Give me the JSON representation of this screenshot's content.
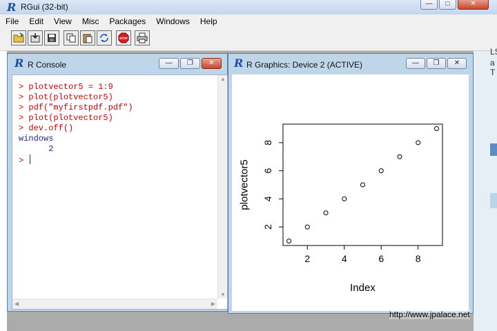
{
  "app": {
    "title": "RGui (32-bit)",
    "logo": "R"
  },
  "menu": [
    "File",
    "Edit",
    "View",
    "Misc",
    "Packages",
    "Windows",
    "Help"
  ],
  "toolbar": {
    "buttons": [
      "open-script-icon",
      "load-workspace-icon",
      "save-icon",
      "copy-icon",
      "paste-icon",
      "copy-paste-icon",
      "stop-icon",
      "print-icon"
    ],
    "stop_label": "STOP"
  },
  "console": {
    "title": "R Console",
    "lines": [
      {
        "prompt": "> ",
        "text": "plotvector5 = 1:9",
        "kind": "cmd"
      },
      {
        "prompt": "> ",
        "text": "plot(plotvector5)",
        "kind": "cmd"
      },
      {
        "prompt": "> ",
        "text": "pdf(\"myfirstpdf.pdf\")",
        "kind": "cmd"
      },
      {
        "prompt": "> ",
        "text": "plot(plotvector5)",
        "kind": "cmd"
      },
      {
        "prompt": "> ",
        "text": "dev.off()",
        "kind": "cmd"
      },
      {
        "prompt": "",
        "text": "windows",
        "kind": "out"
      },
      {
        "prompt": "",
        "text": "      2",
        "kind": "out"
      },
      {
        "prompt": "> ",
        "text": "",
        "kind": "cmd"
      }
    ]
  },
  "graphics": {
    "title": "R Graphics: Device 2 (ACTIVE)",
    "chart_data": {
      "type": "scatter",
      "x": [
        1,
        2,
        3,
        4,
        5,
        6,
        7,
        8,
        9
      ],
      "y": [
        1,
        2,
        3,
        4,
        5,
        6,
        7,
        8,
        9
      ],
      "xlabel": "Index",
      "ylabel": "plotvector5",
      "xlim": [
        1,
        9
      ],
      "ylim": [
        1,
        9
      ],
      "xticks": [
        "2",
        "4",
        "6",
        "8"
      ],
      "yticks": [
        "2",
        "4",
        "6",
        "8"
      ],
      "marker": "open-circle",
      "grid": false
    }
  },
  "background": {
    "right_fragments": [
      "LS",
      "a T"
    ]
  },
  "watermark": "http://www.jpalace.net"
}
